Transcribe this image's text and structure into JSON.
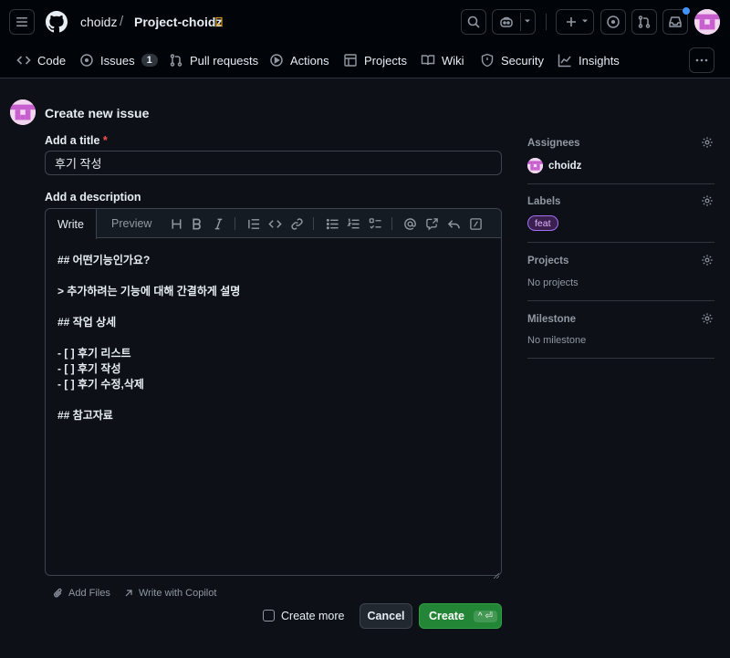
{
  "header": {
    "owner": "choidz",
    "separator": "/",
    "repo": "Project-choidz"
  },
  "nav": {
    "code": "Code",
    "issues": "Issues",
    "issues_count": "1",
    "pull_requests": "Pull requests",
    "actions": "Actions",
    "projects": "Projects",
    "wiki": "Wiki",
    "security": "Security",
    "insights": "Insights"
  },
  "page": {
    "heading": "Create new issue",
    "title_label": "Add a title",
    "required_mark": "*",
    "title_value": "후기 작성",
    "description_label": "Add a description"
  },
  "editor": {
    "tab_write": "Write",
    "tab_preview": "Preview",
    "lines": [
      "## 어떤기능인가요?",
      "",
      "> 추가하려는 기능에 대해 간결하게 설명",
      "",
      "## 작업 상세",
      "",
      "- [ ] 후기 리스트",
      "- [ ] 후기 작성",
      "- [ ] 후기 수정,삭제",
      "",
      "## 참고자료"
    ]
  },
  "footer": {
    "add_files": "Add Files",
    "write_with_copilot": "Write with Copilot",
    "create_more": "Create more",
    "cancel": "Cancel",
    "create": "Create",
    "create_shortcut": "^ ⏎"
  },
  "sidebar": {
    "assignees_label": "Assignees",
    "assignee_name": "choidz",
    "labels_label": "Labels",
    "label_tag": "feat",
    "projects_label": "Projects",
    "projects_value": "No projects",
    "milestone_label": "Milestone",
    "milestone_value": "No milestone"
  },
  "colors": {
    "background": "#0d1117",
    "header_bg": "#010409",
    "create_button": "#238636",
    "label_border": "#a371f7"
  }
}
